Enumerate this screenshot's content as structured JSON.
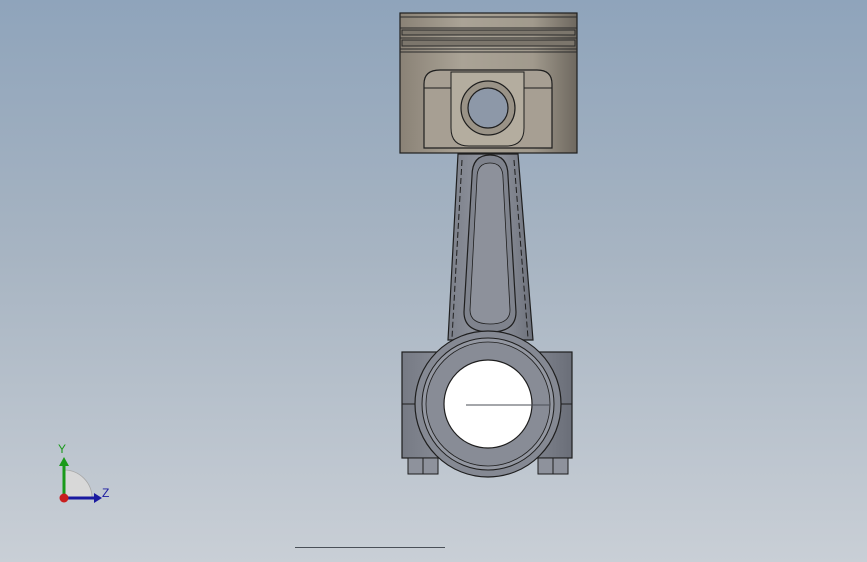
{
  "viewport": {
    "background_top": "#8fa4bb",
    "background_bottom": "#c9cfd6"
  },
  "model": {
    "name": "piston-connecting-rod-assembly",
    "piston_color": "#a39b8f",
    "rod_color": "#8a8e98",
    "edge_color": "#1e1e1e"
  },
  "triad": {
    "y_label": "Y",
    "z_label": "Z",
    "y_color": "#1a9a1a",
    "z_color": "#1a1aa0",
    "x_color": "#c81e1e"
  }
}
